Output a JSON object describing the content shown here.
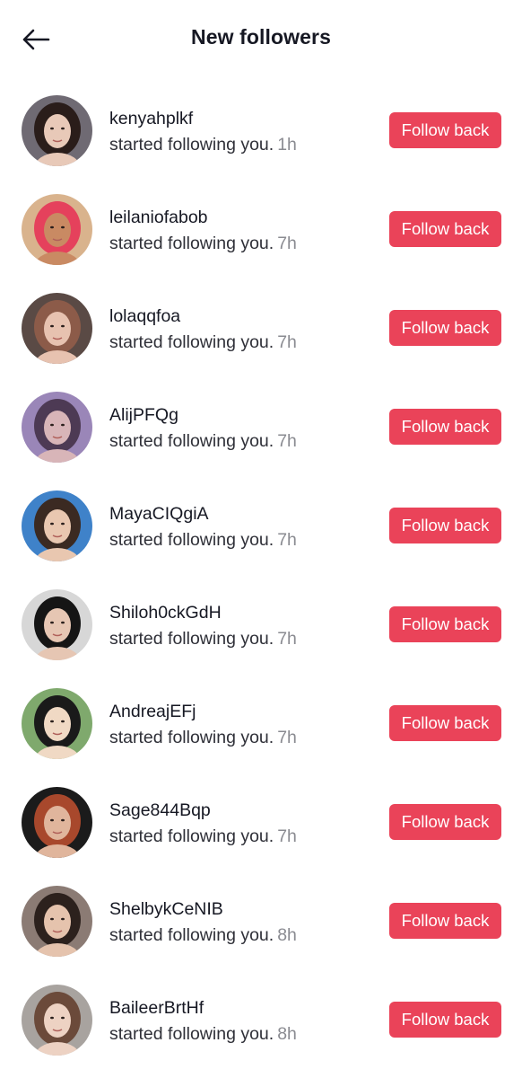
{
  "header": {
    "title": "New followers",
    "back_icon": "arrow-left-icon"
  },
  "colors": {
    "accent": "#EA4359",
    "text_primary": "#161823",
    "text_secondary": "#8A8B91"
  },
  "followers": [
    {
      "username": "kenyahplkf",
      "action": "started following you.",
      "time": "1h",
      "button": "Follow back",
      "avatar_palette": [
        "#6f6a73",
        "#e8c9b8",
        "#2a1d1a"
      ]
    },
    {
      "username": "leilaniofabob",
      "action": "started following you.",
      "time": "7h",
      "button": "Follow back",
      "avatar_palette": [
        "#d9b38d",
        "#c98a63",
        "#e5415c"
      ]
    },
    {
      "username": "lolaqqfoa",
      "action": "started following you.",
      "time": "7h",
      "button": "Follow back",
      "avatar_palette": [
        "#5a4a45",
        "#e7c2b0",
        "#8c5b49"
      ]
    },
    {
      "username": "AlijPFQg",
      "action": "started following you.",
      "time": "7h",
      "button": "Follow back",
      "avatar_palette": [
        "#9a86b8",
        "#d8b5b8",
        "#4d3a54"
      ]
    },
    {
      "username": "MayaCIQgiA",
      "action": "started following you.",
      "time": "7h",
      "button": "Follow back",
      "avatar_palette": [
        "#3f82c9",
        "#e9c7b0",
        "#3b2a22"
      ]
    },
    {
      "username": "Shiloh0ckGdH",
      "action": "started following you.",
      "time": "7h",
      "button": "Follow back",
      "avatar_palette": [
        "#d7d7d7",
        "#e6c6b3",
        "#151515"
      ]
    },
    {
      "username": "AndreajEFj",
      "action": "started following you.",
      "time": "7h",
      "button": "Follow back",
      "avatar_palette": [
        "#7fa96d",
        "#f0d9c4",
        "#1a1a1a"
      ]
    },
    {
      "username": "Sage844Bqp",
      "action": "started following you.",
      "time": "7h",
      "button": "Follow back",
      "avatar_palette": [
        "#1b1b1b",
        "#e0b59c",
        "#a8482c"
      ]
    },
    {
      "username": "ShelbykCeNIB",
      "action": "started following you.",
      "time": "8h",
      "button": "Follow back",
      "avatar_palette": [
        "#8b7b74",
        "#e5c3ad",
        "#2c211d"
      ]
    },
    {
      "username": "BaileerBrtHf",
      "action": "started following you.",
      "time": "8h",
      "button": "Follow back",
      "avatar_palette": [
        "#a8a39f",
        "#edd2c3",
        "#6b4a3a"
      ]
    }
  ]
}
